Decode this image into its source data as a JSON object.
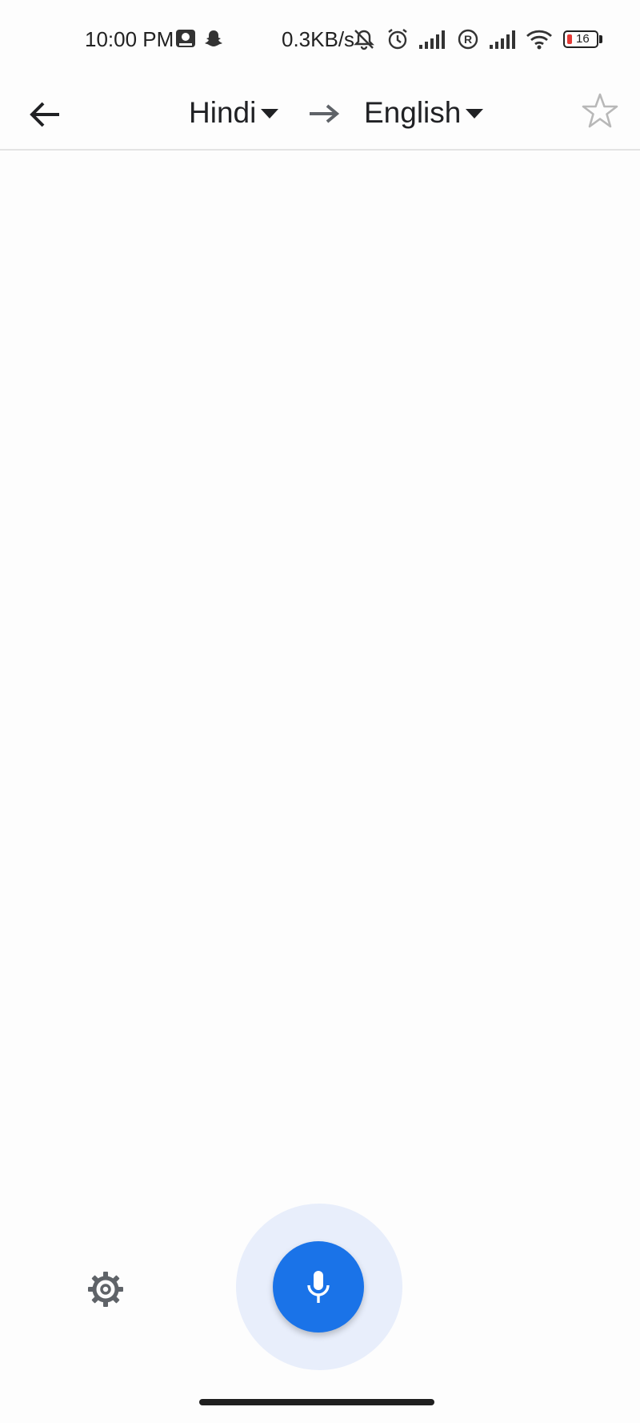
{
  "status_bar": {
    "time": "10:00 PM",
    "network_speed": "0.3KB/s",
    "battery_level": "16",
    "battery_color": "#e53935",
    "icons": [
      "app-notification-icon",
      "snapchat-icon",
      "mute-icon",
      "alarm-icon",
      "signal-icon",
      "roaming-icon",
      "signal-icon",
      "wifi-icon",
      "battery-icon"
    ]
  },
  "toolbar": {
    "back_icon": "arrow-left-icon",
    "source_language": "Hindi",
    "target_language": "English",
    "direction_icon": "arrow-right-icon",
    "favorite_icon": "star-outline-icon"
  },
  "bottom_bar": {
    "settings_icon": "gear-icon",
    "mic_icon": "microphone-icon",
    "accent_color": "#1a73e8",
    "halo_color": "#e8eefb"
  }
}
